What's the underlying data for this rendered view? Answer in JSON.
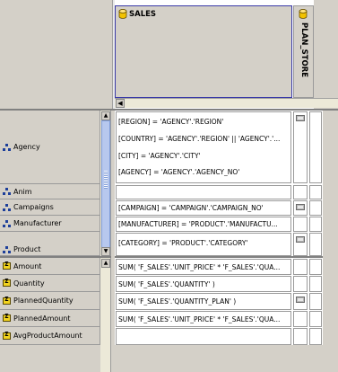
{
  "header": {
    "sales_panel": {
      "title": "SALES"
    },
    "plan_store_panel": {
      "title": "PLAN_STORE"
    }
  },
  "dimensions": [
    {
      "label": "Agency"
    },
    {
      "label": "Anim"
    },
    {
      "label": "Campaigns"
    },
    {
      "label": "Manufacturer"
    },
    {
      "label": "Product"
    }
  ],
  "dimension_formulas": {
    "agency": [
      "[REGION] = 'AGENCY'.'REGION'",
      "[COUNTRY] = 'AGENCY'.'REGION' || 'AGENCY'.'...",
      "[CITY] = 'AGENCY'.'CITY'",
      "[AGENCY] = 'AGENCY'.'AGENCY_NO'"
    ],
    "anim": "",
    "campaigns": "[CAMPAIGN] = 'CAMPAIGN'.'CAMPAIGN_NO'",
    "manufacturer": "[MANUFACTURER] = 'PRODUCT'.'MANUFACTU...",
    "product": "[CATEGORY] = 'PRODUCT'.'CATEGORY'"
  },
  "measures": [
    {
      "label": "Amount",
      "formula": "SUM( 'F_SALES'.'UNIT_PRICE' * 'F_SALES'.'QUA..."
    },
    {
      "label": "Quantity",
      "formula": "SUM( 'F_SALES'.'QUANTITY' )"
    },
    {
      "label": "PlannedQuantity",
      "formula": "SUM( 'F_SALES'.'QUANTITY_PLAN' )"
    },
    {
      "label": "PlannedAmount",
      "formula": "SUM( 'F_SALES'.'UNIT_PRICE' * 'F_SALES'.'QUA..."
    },
    {
      "label": "AvgProductAmount",
      "formula": ""
    }
  ],
  "colors": {
    "panel_gray": "#d4d0c8",
    "selection_border": "#3a3aa8",
    "dimension_icon": "#1d3f9a",
    "measure_icon": "#f2d31f",
    "scroll_thumb": "#b7c8ee"
  }
}
